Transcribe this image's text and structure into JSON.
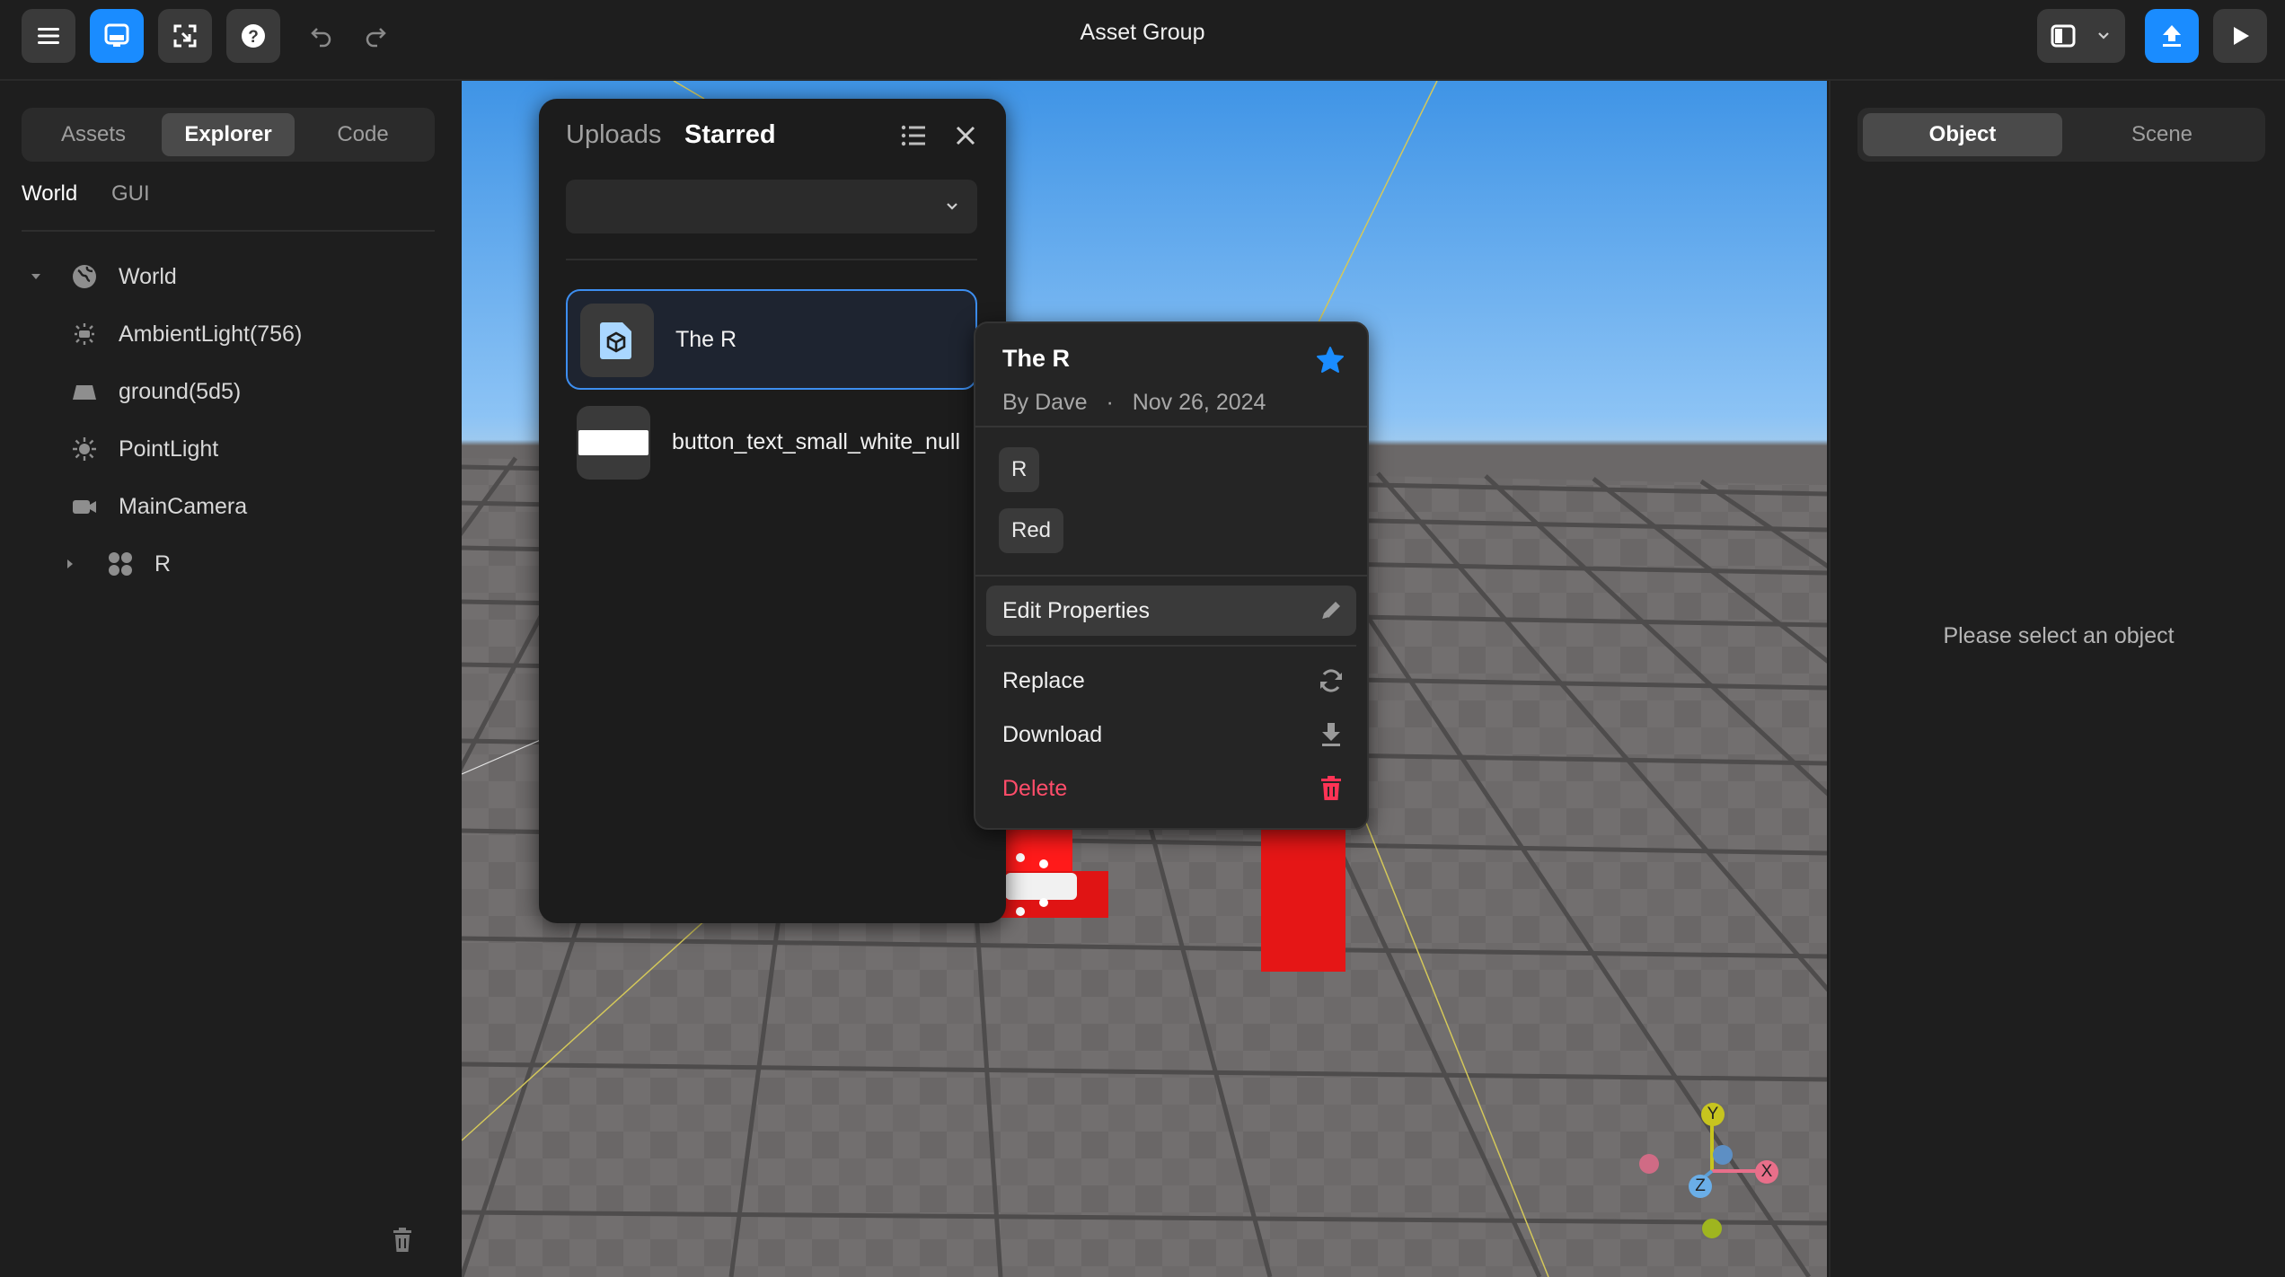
{
  "app": {
    "title": "Asset Group"
  },
  "left_panel": {
    "tabs": [
      {
        "label": "Assets",
        "active": false
      },
      {
        "label": "Explorer",
        "active": true
      },
      {
        "label": "Code",
        "active": false
      }
    ],
    "subtabs": [
      {
        "label": "World",
        "active": true
      },
      {
        "label": "GUI",
        "active": false
      }
    ],
    "tree": [
      {
        "label": "World",
        "icon": "globe-icon"
      },
      {
        "label": "AmbientLight(756)",
        "icon": "ambient-light-icon"
      },
      {
        "label": "ground(5d5)",
        "icon": "ground-icon"
      },
      {
        "label": "PointLight",
        "icon": "sun-icon"
      },
      {
        "label": "MainCamera",
        "icon": "camera-icon"
      },
      {
        "label": "R",
        "icon": "group-icon"
      }
    ]
  },
  "asset_popup": {
    "tabs": [
      {
        "label": "Uploads",
        "active": false
      },
      {
        "label": "Starred",
        "active": true
      }
    ],
    "dropdown_value": "",
    "assets": [
      {
        "name": "The R",
        "selected": true,
        "icon": "model-icon"
      },
      {
        "name": "button_text_small_white_null",
        "selected": false,
        "icon": "image-thumbnail"
      }
    ]
  },
  "context_menu": {
    "title": "The R",
    "author": "By Dave",
    "separator": "·",
    "date": "Nov 26, 2024",
    "tags": [
      "R",
      "Red"
    ],
    "items": [
      {
        "label": "Edit Properties",
        "icon": "pencil-icon"
      },
      {
        "label": "Replace",
        "icon": "refresh-icon"
      },
      {
        "label": "Download",
        "icon": "download-icon"
      },
      {
        "label": "Delete",
        "icon": "trash-icon"
      }
    ],
    "colors": {
      "star": "#1a8cff",
      "delete": "#ff4d6a"
    }
  },
  "right_panel": {
    "tabs": [
      {
        "label": "Object",
        "active": true
      },
      {
        "label": "Scene",
        "active": false
      }
    ],
    "placeholder": "Please select an object"
  },
  "gizmo": {
    "y": "Y",
    "x": "X",
    "z": "Z"
  },
  "colors": {
    "accent": "#1a8cff"
  }
}
